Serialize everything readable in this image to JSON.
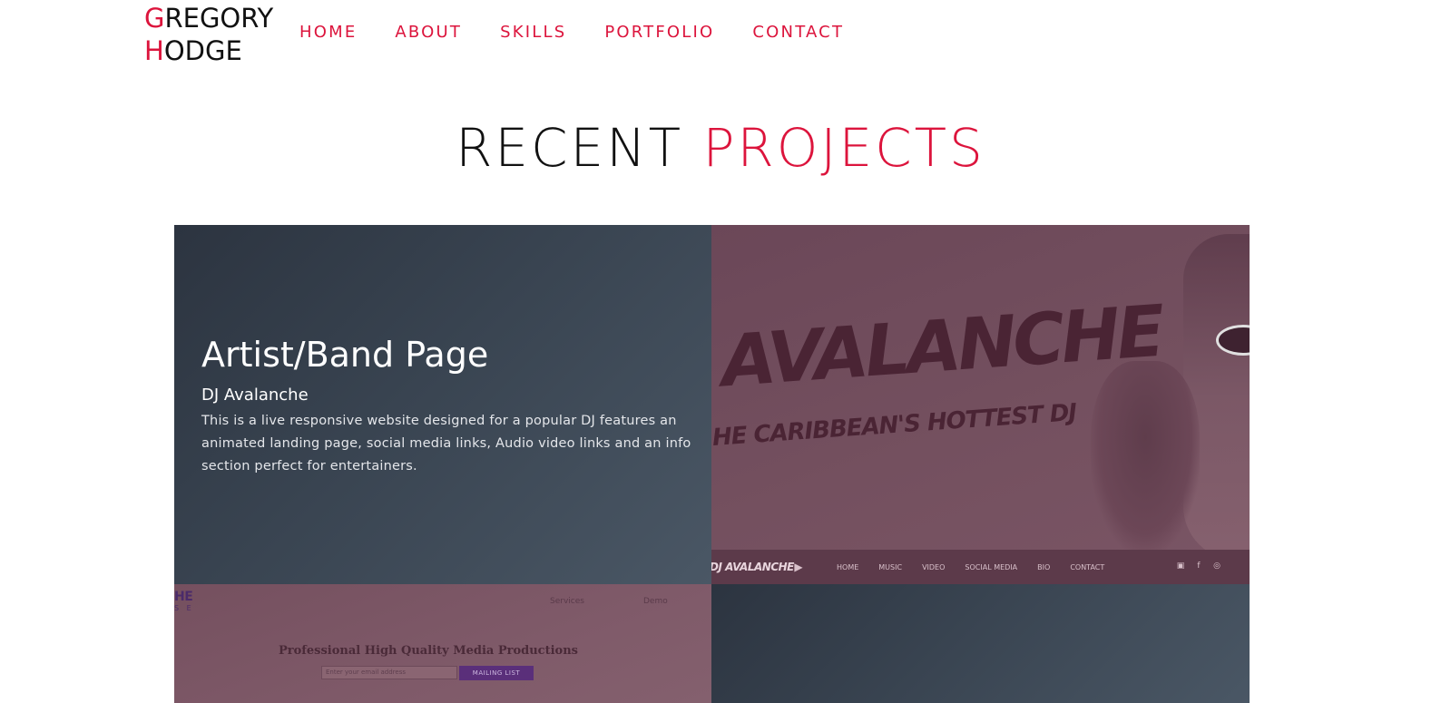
{
  "header": {
    "logo": {
      "first_initial": "G",
      "first_rest": "REGORY",
      "last_initial": "H",
      "last_rest": "ODGE"
    },
    "nav": [
      {
        "label": "HOME"
      },
      {
        "label": "ABOUT"
      },
      {
        "label": "SKILLS"
      },
      {
        "label": "PORTFOLIO"
      },
      {
        "label": "CONTACT"
      }
    ]
  },
  "section": {
    "title_word1": "RECENT",
    "title_word2": "PROJECTS"
  },
  "projects": [
    {
      "title": "Artist/Band Page",
      "subtitle": "DJ Avalanche",
      "description": "This is a live responsive website designed for a popular DJ features an animated landing page, social media links, Audio video links and an info section perfect for entertainers.",
      "preview": {
        "logo_text": "J AVALANCHE",
        "tagline": "HE CARIBBEAN'S HOTTEST DJ",
        "mini_nav_logo": "DJ AVALANCHE",
        "mini_nav_items": [
          "HOME",
          "MUSIC",
          "VIDEO",
          "SOCIAL MEDIA",
          "BIO",
          "CONTACT"
        ]
      }
    },
    {
      "preview": {
        "logo_line1": "HE",
        "logo_line2": "S E",
        "nav_items": [
          "Services",
          "Demo"
        ],
        "heading": "Professional High Quality Media Productions",
        "input_placeholder": "Enter your email address",
        "button_label": "MAILING LIST"
      }
    }
  ],
  "colors": {
    "accent": "#dc143c",
    "card_dark": "#394451",
    "overlay_mauve": "#74505f"
  }
}
